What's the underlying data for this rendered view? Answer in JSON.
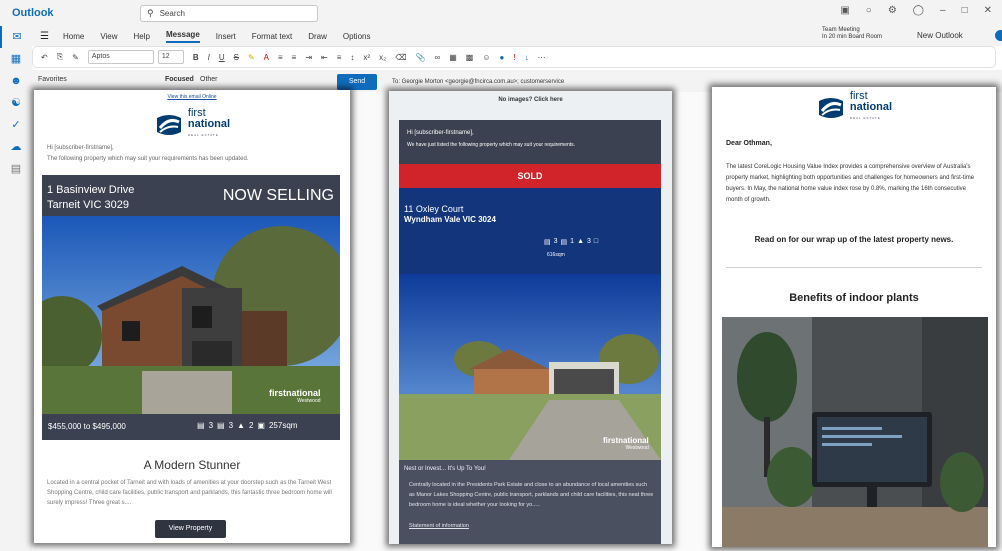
{
  "app": {
    "title": "Outlook"
  },
  "search": {
    "placeholder": "Search"
  },
  "titlebar": {
    "meeting_title": "Team Meeting",
    "meeting_detail": "In 20 min Board Room",
    "new_outlook_label": "New Outlook"
  },
  "ribbon": {
    "tabs": [
      "Home",
      "View",
      "Help",
      "Message",
      "Insert",
      "Format text",
      "Draw",
      "Options"
    ],
    "active_tab": "Message",
    "font_name": "Aptos",
    "font_size": "12"
  },
  "folders": {
    "favorites": "Favorites",
    "focused": "Focused",
    "other": "Other"
  },
  "compose": {
    "send_label": "Send",
    "to_line": "To: Georgie Morton <georgie@fncirca.com.au>; customerservice"
  },
  "colors": {
    "accent": "#0f6cbd",
    "navy": "#12357c",
    "sold_red": "#d0232a",
    "slate": "#3b4150"
  },
  "email1": {
    "view_online": "View this email Online",
    "logo_word1": "first",
    "logo_word2": "national",
    "logo_tag": "REAL ESTATE",
    "greeting": "Hi [subscriber-firstname],",
    "intro": "The following property which may suit your requirements has been updated.",
    "address_line1": "1 Basinview Drive",
    "address_line2": "Tarneit VIC 3029",
    "status": "NOW SELLING",
    "price": "$455,000 to $495,000",
    "beds": "3",
    "baths": "3",
    "cars": "2",
    "land": "257sqm",
    "watermark_brand": "firstnational",
    "watermark_office": "Westwood",
    "heading": "A Modern Stunner",
    "description": "Located in a central pocket of Tarneit and with loads of amenities at your doorstep such as the Tarneit West Shopping Centre, child care facilities, public transport and parklands, this fantastic three bedroom home will surely impress! Three great s....",
    "button_label": "View Property"
  },
  "email2": {
    "no_images": "No images? Click here",
    "greeting": "Hi [subscriber-firstname],",
    "intro": "We have just listed the following property which may suit your requirements.",
    "status": "SOLD",
    "address_line1": "11 Oxley Court",
    "address_line2": "Wyndham Vale VIC 3024",
    "beds": "3",
    "baths": "1",
    "cars": "3",
    "area": "616sqm",
    "watermark_brand": "firstnational",
    "watermark_office": "Westwood",
    "heading": "Nest or Invest... It's Up To You!",
    "description": "Centrally located in the Presidents Park Estate and close to an abundance of local amenities such as Manor Lakes Shopping Centre, public transport, parklands and child care facilities, this neat three bedroom home is ideal whether your looking for yo.....",
    "link_label": "Statement of information"
  },
  "email3": {
    "logo_word1": "first",
    "logo_word2": "national",
    "logo_tag": "REAL ESTATE",
    "salutation": "Dear Othman,",
    "paragraph": "The latest CoreLogic Housing Value Index provides a comprehensive overview of Australia's property market, highlighting both opportunities and challenges for homeowners and first-time buyers. In May, the national home value index rose by 0.8%, marking the 16th consecutive month of growth.",
    "read_on": "Read on for our wrap up of the latest property news.",
    "article_title": "Benefits of indoor plants"
  }
}
